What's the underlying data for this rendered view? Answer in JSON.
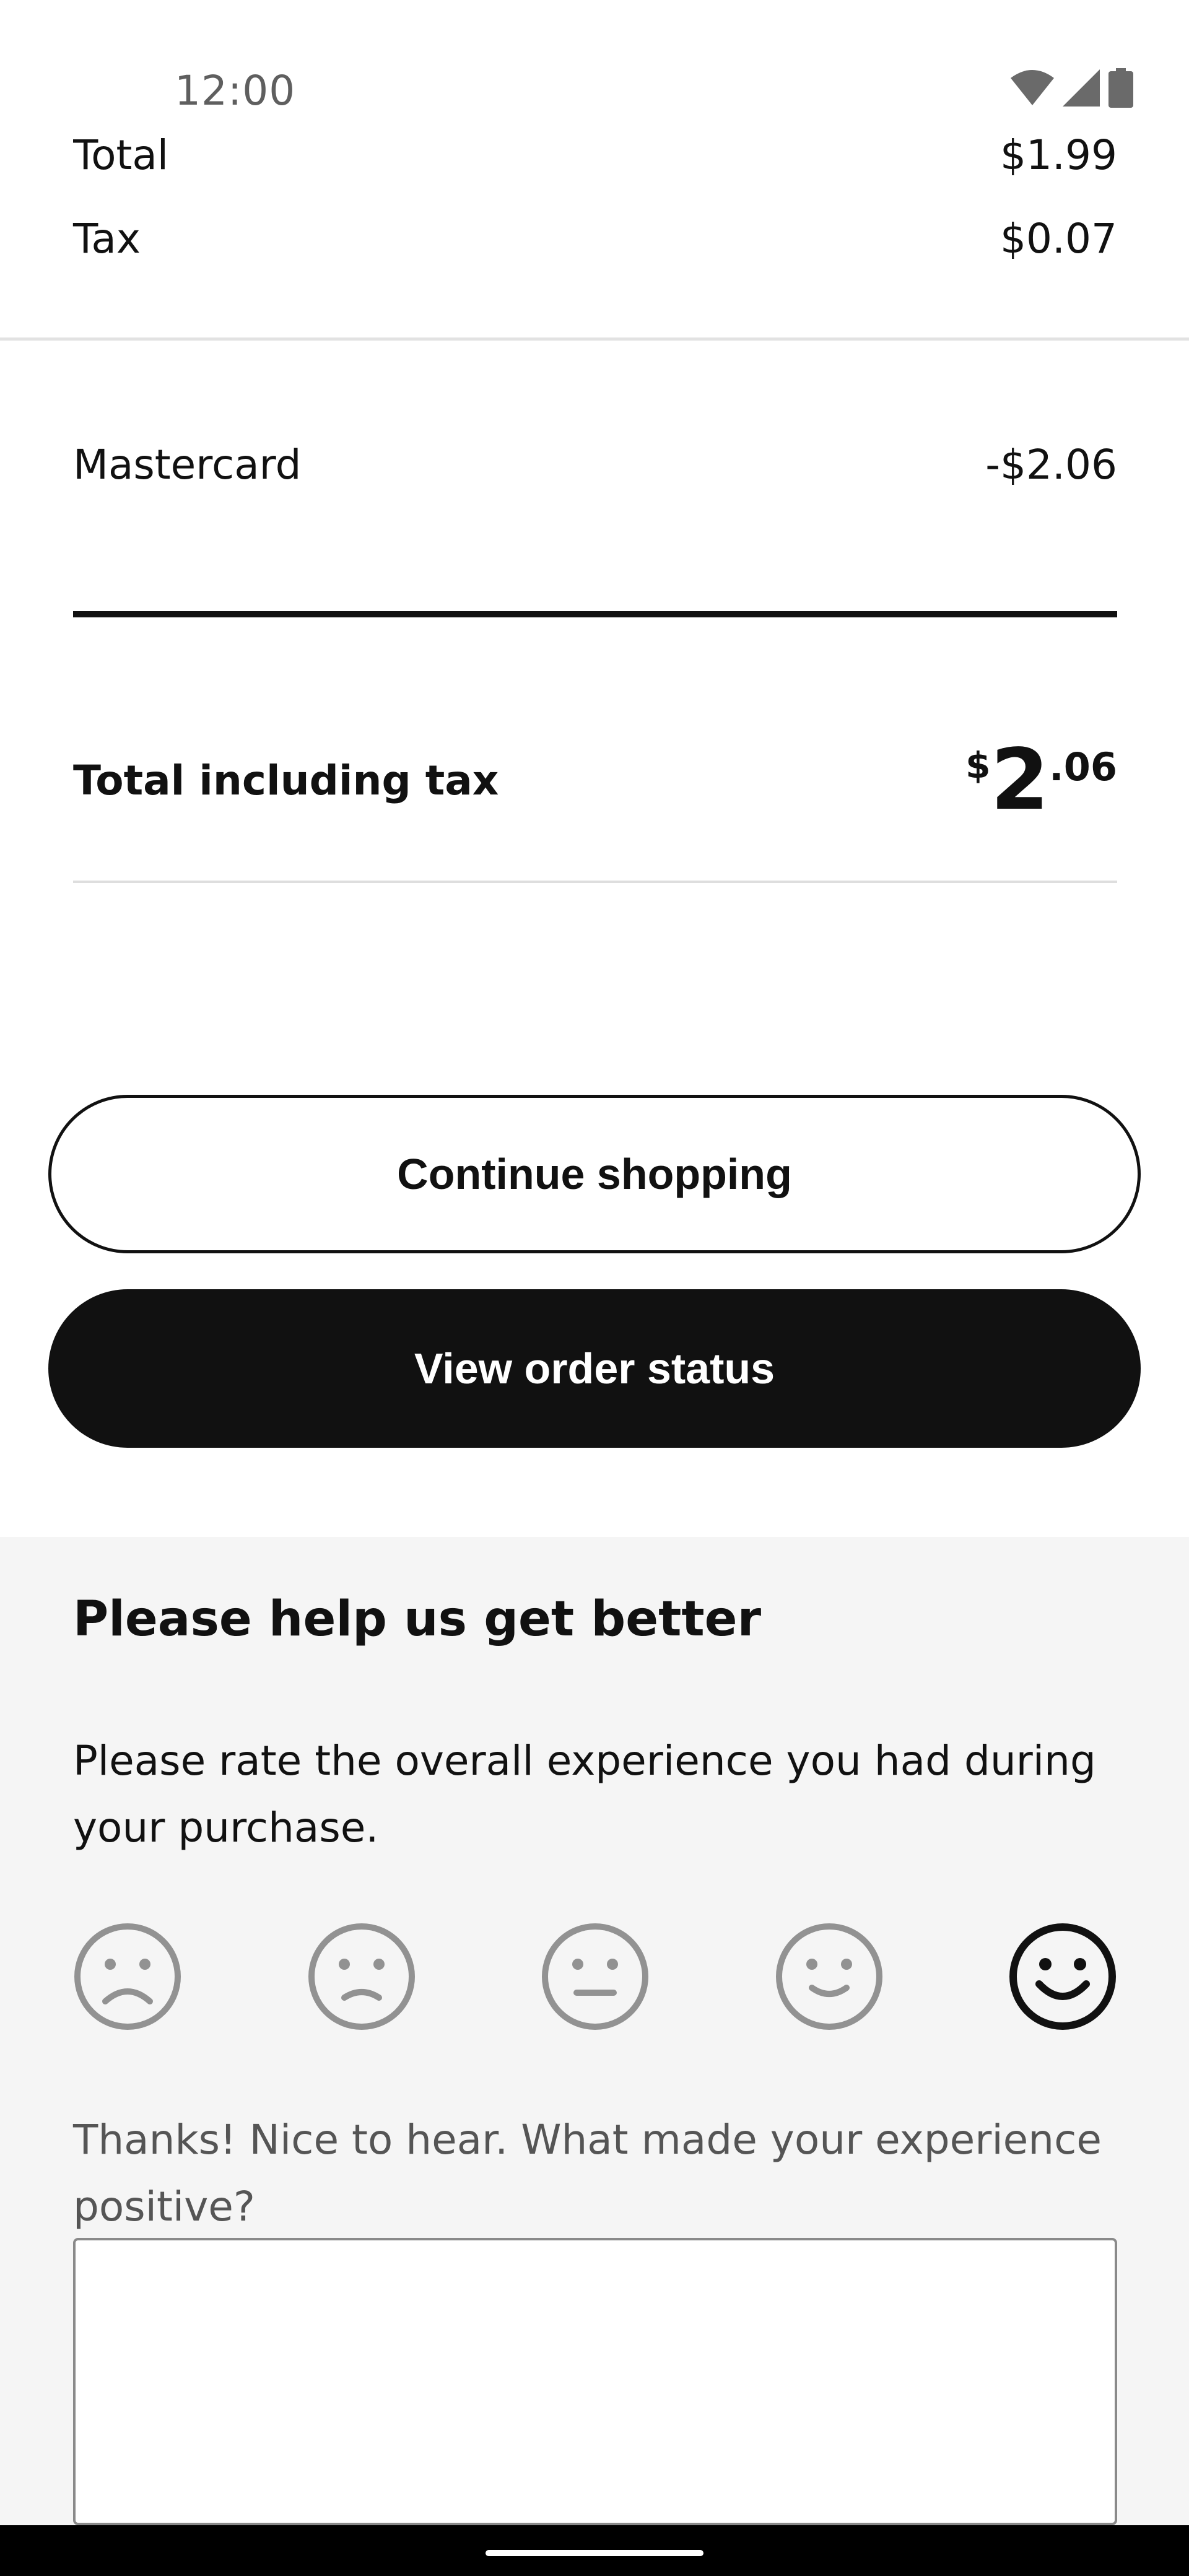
{
  "status_bar": {
    "time": "12:00"
  },
  "summary": {
    "total_label": "Total",
    "total_value": "$1.99",
    "tax_label": "Tax",
    "tax_value": "$0.07"
  },
  "payment": {
    "method_label": "Mastercard",
    "method_value": "-$2.06"
  },
  "grand_total": {
    "label": "Total including tax",
    "currency": "$",
    "integer": "2",
    "decimal": ".06"
  },
  "buttons": {
    "continue_label": "Continue shopping",
    "view_order_label": "View order status"
  },
  "feedback": {
    "title": "Please help us get better",
    "description": "Please rate the overall experience you had during your purchase.",
    "ratings": [
      "very-dissatisfied",
      "dissatisfied",
      "neutral",
      "satisfied",
      "very-satisfied"
    ],
    "selected_rating": "very-satisfied",
    "prompt": "Thanks! Nice to hear. What made your experience positive?",
    "textarea_value": ""
  },
  "colors": {
    "primary": "#111111",
    "unselected_face": "#929292",
    "section_bg": "#f5f5f5"
  }
}
